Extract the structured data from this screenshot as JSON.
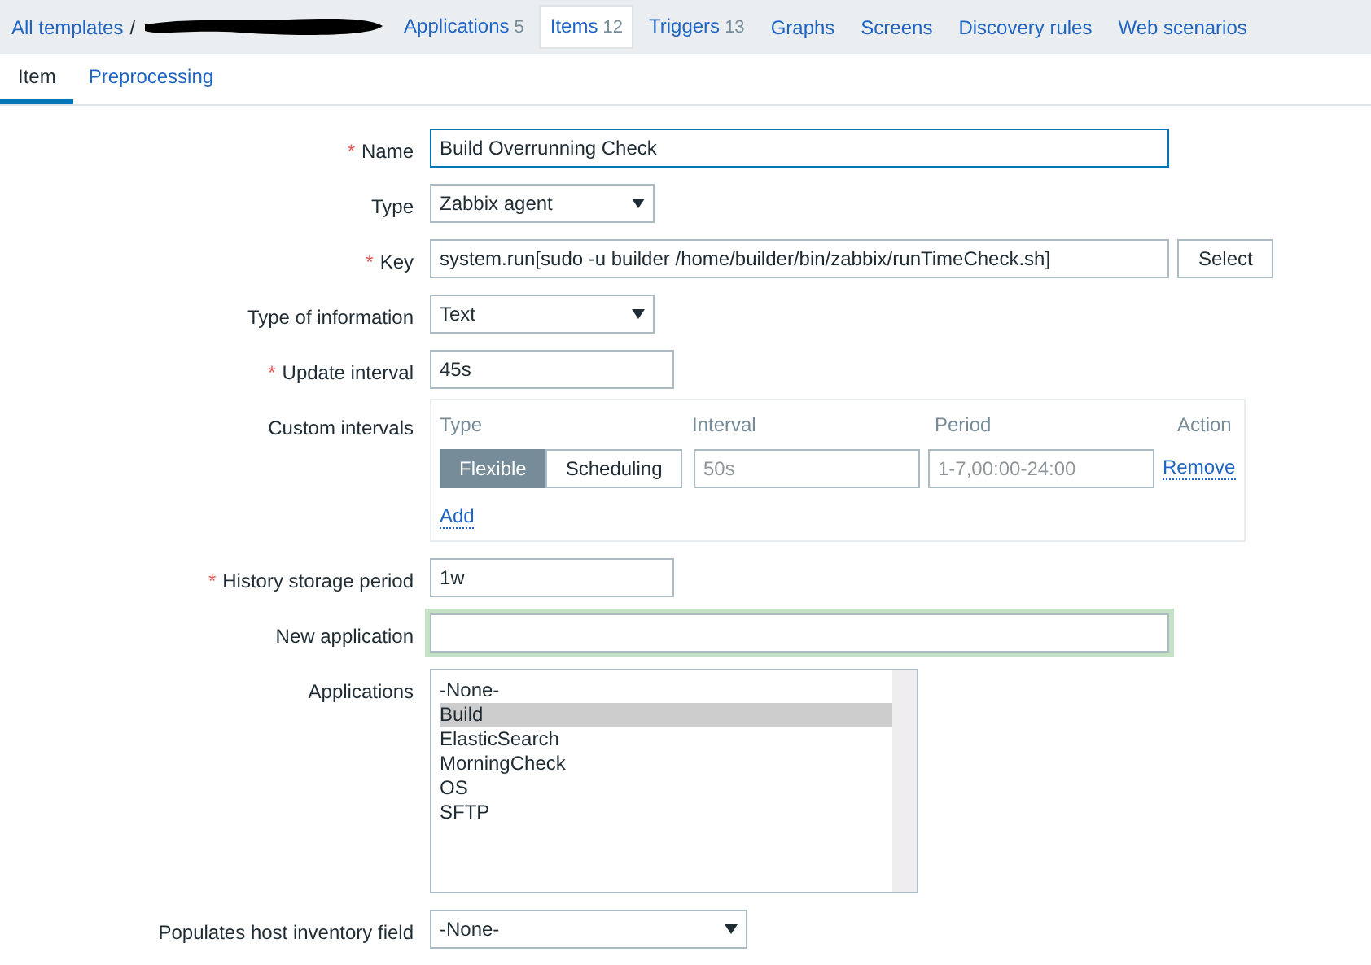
{
  "breadcrumb": {
    "root": "All templates",
    "separator": "/"
  },
  "nav_tabs": [
    {
      "label": "Applications",
      "count": "5",
      "selected": false
    },
    {
      "label": "Items",
      "count": "12",
      "selected": true
    },
    {
      "label": "Triggers",
      "count": "13",
      "selected": false
    },
    {
      "label": "Graphs",
      "selected": false
    },
    {
      "label": "Screens",
      "selected": false
    },
    {
      "label": "Discovery rules",
      "selected": false
    },
    {
      "label": "Web scenarios",
      "selected": false
    }
  ],
  "form_tabs": [
    {
      "label": "Item",
      "selected": true
    },
    {
      "label": "Preprocessing",
      "selected": false
    }
  ],
  "fields": [
    {
      "kind": "text",
      "label": "Name",
      "required_mark": "*",
      "value": "Build Overrunning Check",
      "focused": true
    },
    {
      "kind": "select",
      "label": "Type",
      "value": "Zabbix agent"
    },
    {
      "kind": "text",
      "label": "Key",
      "required_mark": "*",
      "value": "system.run[sudo -u builder /home/builder/bin/zabbix/runTimeCheck.sh]",
      "button": "Select"
    },
    {
      "kind": "select",
      "label": "Type of information",
      "value": "Text"
    },
    {
      "kind": "text",
      "label": "Update interval",
      "required_mark": "*",
      "value": "45s"
    },
    {
      "kind": "intervals",
      "label": "Custom intervals",
      "columns": [
        "Type",
        "Interval",
        "Period",
        "Action"
      ],
      "rows": [
        {
          "types": [
            {
              "label": "Flexible",
              "selected": true
            },
            {
              "label": "Scheduling",
              "selected": false
            }
          ],
          "interval_placeholder": "50s",
          "period_placeholder": "1-7,00:00-24:00",
          "action": "Remove"
        }
      ],
      "add": "Add"
    },
    {
      "kind": "text",
      "label": "History storage period",
      "required_mark": "*",
      "value": "1w"
    },
    {
      "kind": "text",
      "label": "New application",
      "highlighted": true
    },
    {
      "kind": "list",
      "label": "Applications",
      "items": [
        {
          "label": "-None-",
          "selected": false
        },
        {
          "label": "Build",
          "selected": true
        },
        {
          "label": "ElasticSearch",
          "selected": false
        },
        {
          "label": "MorningCheck",
          "selected": false
        },
        {
          "label": "OS",
          "selected": false
        },
        {
          "label": "SFTP",
          "selected": false
        }
      ]
    },
    {
      "kind": "select",
      "label": "Populates host inventory field",
      "value": "-None-"
    }
  ]
}
